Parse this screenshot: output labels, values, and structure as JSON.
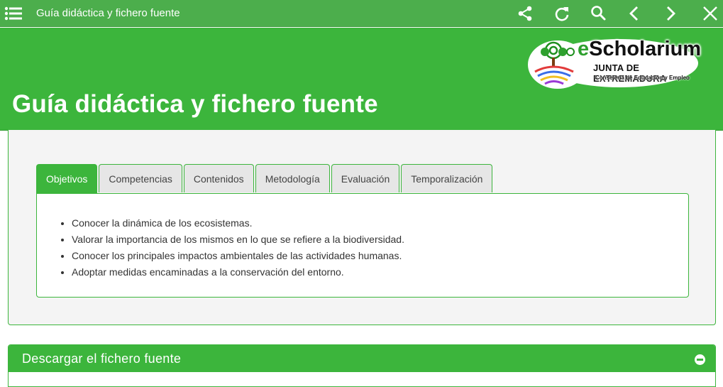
{
  "topbar": {
    "title": "Guía didáctica y fichero fuente",
    "icons": [
      "menu-icon",
      "share-icon",
      "refresh-icon",
      "search-icon",
      "chevron-left-icon",
      "chevron-right-icon",
      "close-icon"
    ]
  },
  "header": {
    "title": "Guía didáctica y fichero fuente",
    "logo": {
      "brand_e": "e",
      "brand_rest": "Scholarium",
      "line1": "JUNTA DE EXTREMADURA",
      "line2": "Consejería de Educación y Empleo"
    }
  },
  "tabs": [
    {
      "label": "Objetivos",
      "active": true
    },
    {
      "label": "Competencias",
      "active": false
    },
    {
      "label": "Contenidos",
      "active": false
    },
    {
      "label": "Metodología",
      "active": false
    },
    {
      "label": "Evaluación",
      "active": false
    },
    {
      "label": "Temporalización",
      "active": false
    }
  ],
  "objectives": [
    "Conocer la dinámica de los ecosistemas.",
    "Valorar la importancia de los mismos en lo que se refiere a la biodiversidad.",
    "Conocer los principales impactos ambientales de las actividades humanas.",
    "Adoptar medidas encaminadas a la conservación del entorno."
  ],
  "download_section": {
    "title": "Descargar el fichero fuente"
  },
  "colors": {
    "topbar": "#4cae4c",
    "accent": "#3cb53c",
    "panel_bg": "#f4f4f4"
  }
}
